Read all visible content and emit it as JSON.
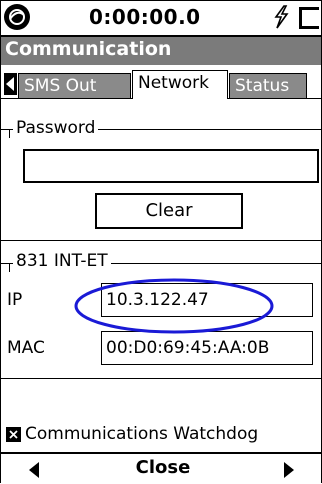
{
  "status_bar": {
    "timer": "0:00:00.0",
    "logo_icon": "larson-davis-logo-icon",
    "power_icon": "lightning-bolt-icon",
    "battery_icon": "battery-icon"
  },
  "window": {
    "title": "Communication"
  },
  "tabs": [
    {
      "label": "SMS Out",
      "active": false
    },
    {
      "label": "Network",
      "active": true
    },
    {
      "label": "Status",
      "active": false
    }
  ],
  "password_group": {
    "label": "Password",
    "value": "",
    "clear_label": "Clear"
  },
  "network_group": {
    "label": "831 INT-ET",
    "ip_label": "IP",
    "ip_value": "10.3.122.47",
    "mac_label": "MAC",
    "mac_value": "00:D0:69:45:AA:0B"
  },
  "watchdog": {
    "checked": true,
    "label": "Communications Watchdog"
  },
  "bottom_bar": {
    "close_label": "Close"
  },
  "colors": {
    "title_bar": "#7b7b7b",
    "inactive_tab": "#8a8a8a",
    "highlight_ellipse": "#1a1ad6"
  }
}
